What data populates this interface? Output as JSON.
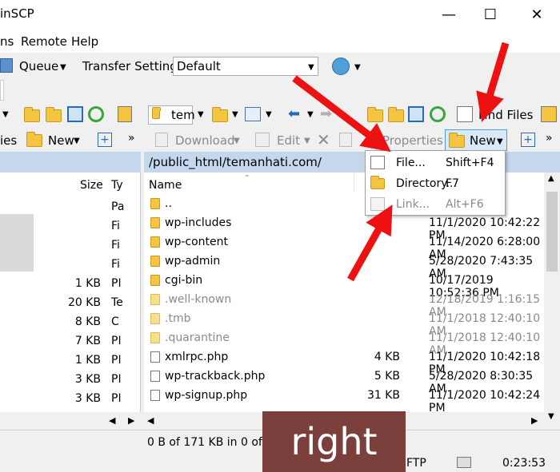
{
  "window": {
    "title": "inSCP",
    "minimize": "—",
    "maximize": "☐",
    "close": "✕"
  },
  "menu": {
    "items": [
      "ns",
      "Remote",
      "Help"
    ]
  },
  "toolbar1": {
    "queue_label": "Queue",
    "transfer_label": "Transfer Settings",
    "transfer_value": "Default"
  },
  "toolbar_right": {
    "folder_combo": "tem",
    "find_files": "Find Files"
  },
  "toolbar_left_row3": {
    "left_cut": "ies",
    "new_label": "New"
  },
  "actions_right": {
    "download": "Download",
    "edit": "Edit",
    "properties": "Properties",
    "new": "New"
  },
  "left_pane": {
    "headers": {
      "size": "Size",
      "type": "Ty"
    },
    "rows": [
      {
        "size": "",
        "type": "Pa"
      },
      {
        "size": "",
        "type": "Fi"
      },
      {
        "size": "",
        "type": "Fi"
      },
      {
        "size": "",
        "type": "Fi"
      },
      {
        "size": "1 KB",
        "type": "PI"
      },
      {
        "size": "20 KB",
        "type": "Te"
      },
      {
        "size": "8 KB",
        "type": "C"
      },
      {
        "size": "7 KB",
        "type": "PI"
      },
      {
        "size": "1 KB",
        "type": "PI"
      },
      {
        "size": "3 KB",
        "type": "PI"
      },
      {
        "size": "3 KB",
        "type": "PI"
      }
    ]
  },
  "right_pane": {
    "path": "/public_html/temanhati.com/",
    "headers": {
      "name": "Name"
    },
    "rows": [
      {
        "name": "..",
        "size": "",
        "date": "",
        "kind": "up"
      },
      {
        "name": "wp-includes",
        "size": "",
        "date": "11/1/2020 10:42:22 PM",
        "kind": "folder"
      },
      {
        "name": "wp-content",
        "size": "",
        "date": "11/14/2020 6:28:00 AM",
        "kind": "folder"
      },
      {
        "name": "wp-admin",
        "size": "",
        "date": "5/28/2020 7:43:35 AM",
        "kind": "folder"
      },
      {
        "name": "cgi-bin",
        "size": "",
        "date": "10/17/2019 10:52:36 PM",
        "kind": "folder"
      },
      {
        "name": ".well-known",
        "size": "",
        "date": "12/18/2019 1:16:15 AM",
        "kind": "hidden"
      },
      {
        "name": ".tmb",
        "size": "",
        "date": "11/1/2018 12:40:10 AM",
        "kind": "hidden"
      },
      {
        "name": ".quarantine",
        "size": "",
        "date": "11/1/2018 12:40:10 AM",
        "kind": "hidden"
      },
      {
        "name": "xmlrpc.php",
        "size": "4 KB",
        "date": "11/1/2020 10:42:18 PM",
        "kind": "file"
      },
      {
        "name": "wp-trackback.php",
        "size": "5 KB",
        "date": "5/28/2020 8:30:35 AM",
        "kind": "file"
      },
      {
        "name": "wp-signup.php",
        "size": "31 KB",
        "date": "11/1/2020 10:42:24 PM",
        "kind": "file"
      }
    ]
  },
  "dropdown": {
    "items": [
      {
        "label": "File...",
        "shortcut": "Shift+F4",
        "enabled": true
      },
      {
        "label": "Directory...",
        "shortcut": "F7",
        "enabled": true
      },
      {
        "label": "Link...",
        "shortcut": "Alt+F6",
        "enabled": false
      }
    ]
  },
  "status": {
    "left": "0 B of 171 KB in 0 of 2",
    "protocol": "FTP",
    "time": "0:23:53"
  },
  "overlay": {
    "label": "right"
  }
}
